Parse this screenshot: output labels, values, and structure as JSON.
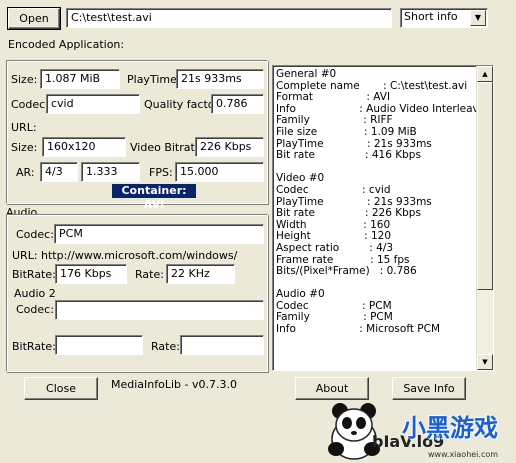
{
  "toolbar": {
    "open_label": "Open",
    "file_path": "C:\\test\\test.avi",
    "view_selected": "Short info",
    "dropdown_arrow": "▼"
  },
  "encoded_application_label": "Encoded Application:",
  "video": {
    "size_label": "Size:",
    "size_value": "1.087 MiB",
    "playtime_label": "PlayTime:",
    "playtime_value": "21s 933ms",
    "codec_label": "Codec:",
    "codec_value": "cvid",
    "quality_label": "Quality factor:",
    "quality_value": "0.786",
    "url_label": "URL:",
    "dim_label": "Size:",
    "dim_value": "160x120",
    "bitrate_label": "Video Bitrate:",
    "bitrate_value": "226 Kbps",
    "ar_label": "AR:",
    "ar_value1": "4/3",
    "ar_value2": "1.333",
    "fps_label": "FPS:",
    "fps_value": "15.000",
    "container_label": "Container: AVI"
  },
  "audio": {
    "section_label": "Audio",
    "codec_label": "Codec:",
    "codec_value": "PCM",
    "url_text": "URL:  http://www.microsoft.com/windows/",
    "bitrate_label": "BitRate:",
    "bitrate_value": "176 Kbps",
    "rate_label": "Rate:",
    "rate_value": "22 KHz",
    "audio2_label": "Audio 2",
    "codec2_label": "Codec:",
    "codec2_value": "",
    "bitrate2_label": "BitRate:",
    "bitrate2_value": "",
    "rate2_label": "Rate:",
    "rate2_value": ""
  },
  "info_text": "General #0\nComplete name       : C:\\test\\test.avi\nFormat                : AVI\nInfo                   : Audio Video Interleave\nFamily                : RIFF\nFile size              : 1.09 MiB\nPlayTime             : 21s 933ms\nBit rate               : 416 Kbps\n\nVideo #0\nCodec                : cvid\nPlayTime             : 21s 933ms\nBit rate               : 226 Kbps\nWidth                 : 160\nHeight                : 120\nAspect ratio         : 4/3\nFrame rate           : 15 fps\nBits/(Pixel*Frame)   : 0.786\n\nAudio #0\nCodec                : PCM\nFamily                : PCM\nInfo                   : Microsoft PCM",
  "scroll": {
    "up_arrow": "▲",
    "down_arrow": "▼"
  },
  "footer": {
    "close_label": "Close",
    "version_text": "MediaInfoLib - v0.7.3.0",
    "about_label": "About",
    "save_label": "Save Info"
  },
  "watermark": {
    "text": "bIaV.lo9",
    "site": "www.xiaohei.com"
  }
}
